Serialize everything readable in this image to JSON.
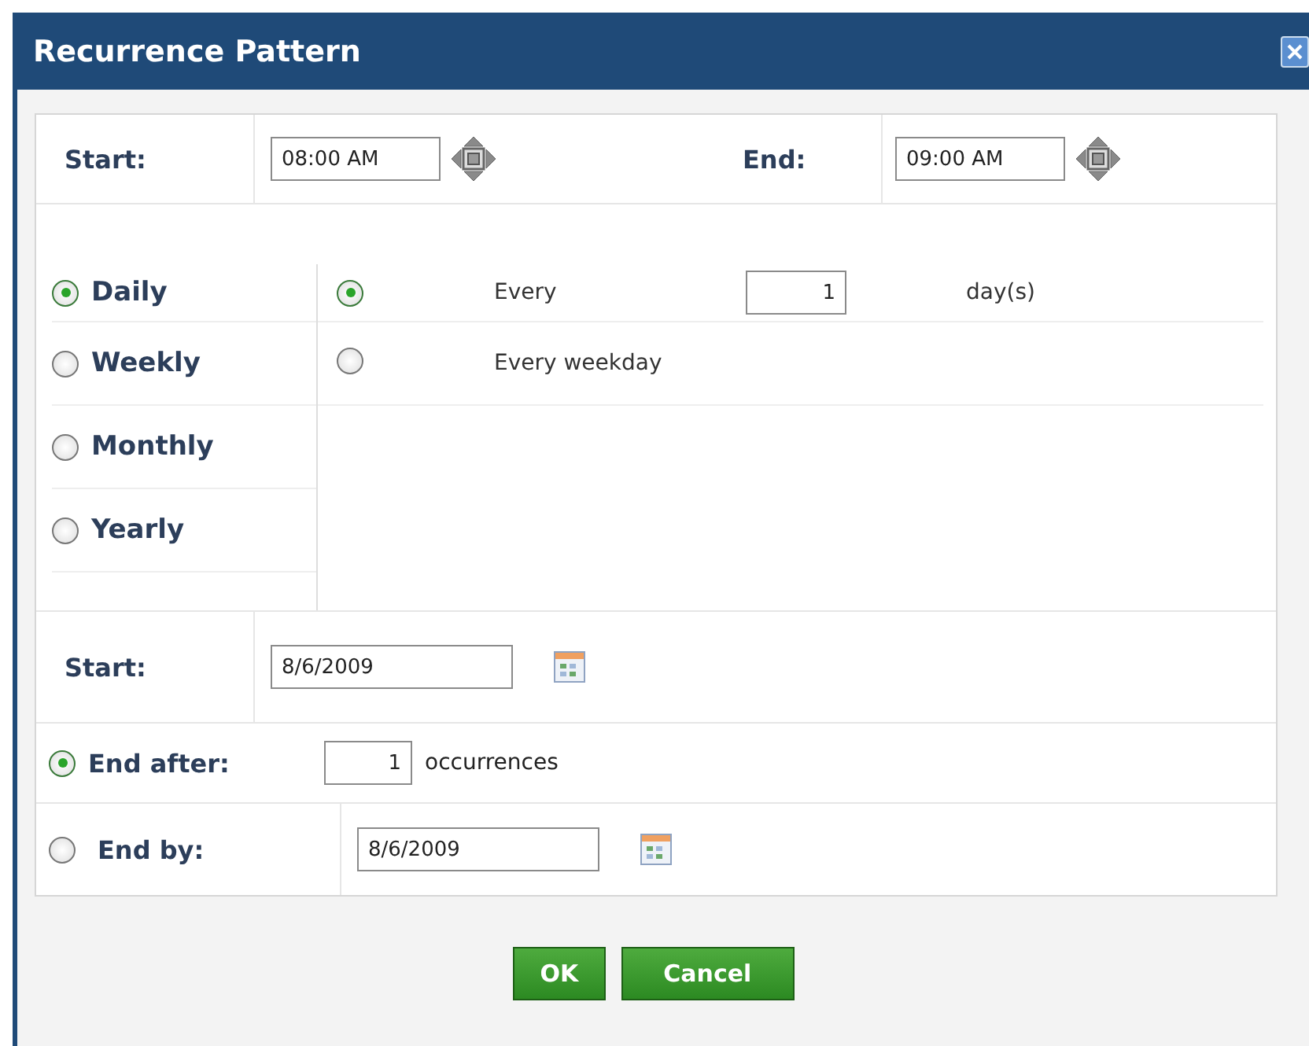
{
  "window": {
    "title": "Recurrence Pattern"
  },
  "time": {
    "start_label": "Start:",
    "start_value": "08:00 AM",
    "end_label": "End:",
    "end_value": "09:00 AM"
  },
  "frequencies": [
    {
      "label": "Daily",
      "selected": true
    },
    {
      "label": "Weekly",
      "selected": false
    },
    {
      "label": "Monthly",
      "selected": false
    },
    {
      "label": "Yearly",
      "selected": false
    }
  ],
  "daily_options": [
    {
      "kind": "interval",
      "selected": true,
      "label": "Every",
      "value": "1",
      "unit": "day(s)"
    },
    {
      "kind": "plain",
      "selected": false,
      "label": "Every weekday"
    }
  ],
  "range": {
    "start_label": "Start:",
    "start_value": "8/6/2009",
    "end_options": [
      {
        "kind": "count",
        "selected": true,
        "label": "End after:",
        "value": "1",
        "unit": "occurrences"
      },
      {
        "kind": "date",
        "selected": false,
        "label": "End by:",
        "value": "8/6/2009"
      }
    ]
  },
  "buttons": [
    "OK",
    "Cancel"
  ]
}
